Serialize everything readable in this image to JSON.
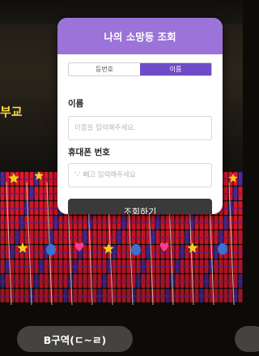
{
  "background": {
    "side_text": "부교",
    "colors": {
      "lantern_red": "#e3172b",
      "lantern_blue": "#4a2a9c",
      "star_yellow": "#f4d01b",
      "heart_pink": "#ff3b9a",
      "bell_blue": "#3e6fd1",
      "side_text": "#f4d84a"
    }
  },
  "modal": {
    "title": "나의 소망등 조회",
    "tabs": [
      {
        "label": "등번호",
        "active": false
      },
      {
        "label": "이름",
        "active": true
      }
    ],
    "name_field": {
      "label": "이름",
      "placeholder": "이름을 입력해주세요.",
      "value": ""
    },
    "phone_field": {
      "label": "휴대폰 번호",
      "placeholder": "'-' 빼고 입력해주세요",
      "value": ""
    },
    "submit_label": "조회하기",
    "colors": {
      "header": "#9b73d9",
      "active_tab": "#6f4cc7",
      "button": "#3a3a3a"
    }
  },
  "zone_selector": {
    "current_label": "B구역(ㄷ~ㄹ)"
  }
}
